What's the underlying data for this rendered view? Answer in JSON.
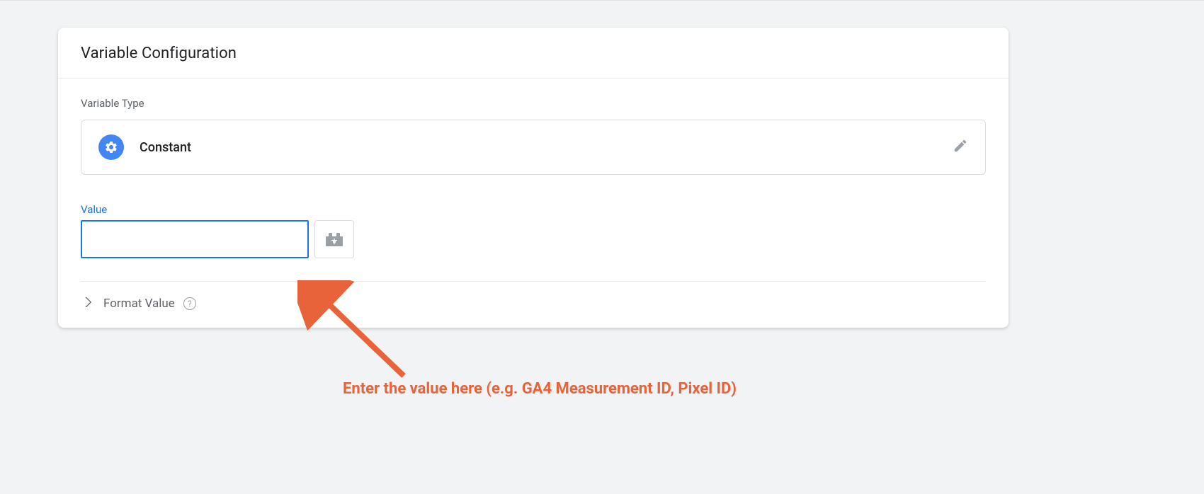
{
  "header": {
    "title": "Variable Configuration"
  },
  "variable_type": {
    "label": "Variable Type",
    "name": "Constant"
  },
  "value_field": {
    "label": "Value",
    "value": ""
  },
  "format_value": {
    "label": "Format Value"
  },
  "annotation": {
    "text": "Enter the value here (e.g. GA4 Measurement ID, Pixel ID)"
  }
}
